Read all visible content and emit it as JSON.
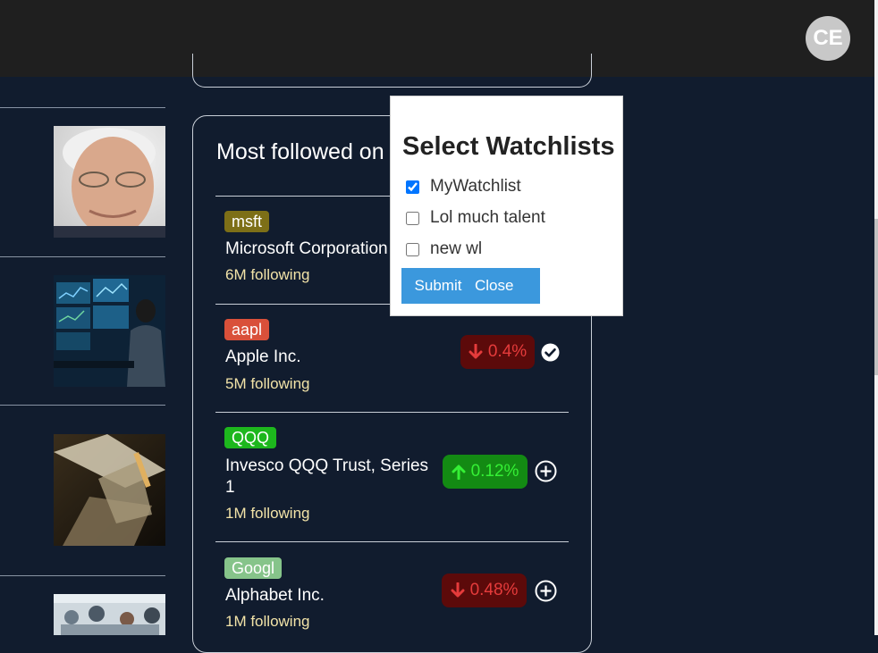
{
  "header": {
    "avatar_initials": "CE"
  },
  "card": {
    "title": "Most followed on"
  },
  "stocks": [
    {
      "ticker": "msft",
      "name": "Microsoft Corporation",
      "following": "6M following",
      "ticker_color": "#7d6f17"
    },
    {
      "ticker": "aapl",
      "name": "Apple Inc.",
      "following": "5M following",
      "change": "0.4%",
      "direction": "down",
      "action_icon": "check-circle-icon",
      "ticker_color": "#d9503a"
    },
    {
      "ticker": "QQQ",
      "name": "Invesco QQQ Trust, Series 1",
      "following": "1M following",
      "change": "0.12%",
      "direction": "up",
      "action_icon": "plus-circle-icon",
      "ticker_color": "#1db71d"
    },
    {
      "ticker": "Googl",
      "name": "Alphabet Inc.",
      "following": "1M following",
      "change": "0.48%",
      "direction": "down",
      "action_icon": "plus-circle-icon",
      "ticker_color": "#86c48a"
    }
  ],
  "modal": {
    "title": "Select Watchlists",
    "options": [
      {
        "label": "MyWatchlist",
        "checked": true
      },
      {
        "label": "Lol much talent",
        "checked": false
      },
      {
        "label": "new wl",
        "checked": false
      }
    ],
    "submit_label": "Submit",
    "close_label": "Close"
  },
  "colors": {
    "background": "#111c2e",
    "topbar": "#1f1f1f",
    "accent": "#3b98dd",
    "down_bg": "#5c0a0a",
    "up_bg": "#138a13",
    "following_text": "#f2e3a8"
  },
  "left_thumbnails": [
    "portrait-photo",
    "trading-desk-photo",
    "currency-photo",
    "trading-floor-photo"
  ]
}
